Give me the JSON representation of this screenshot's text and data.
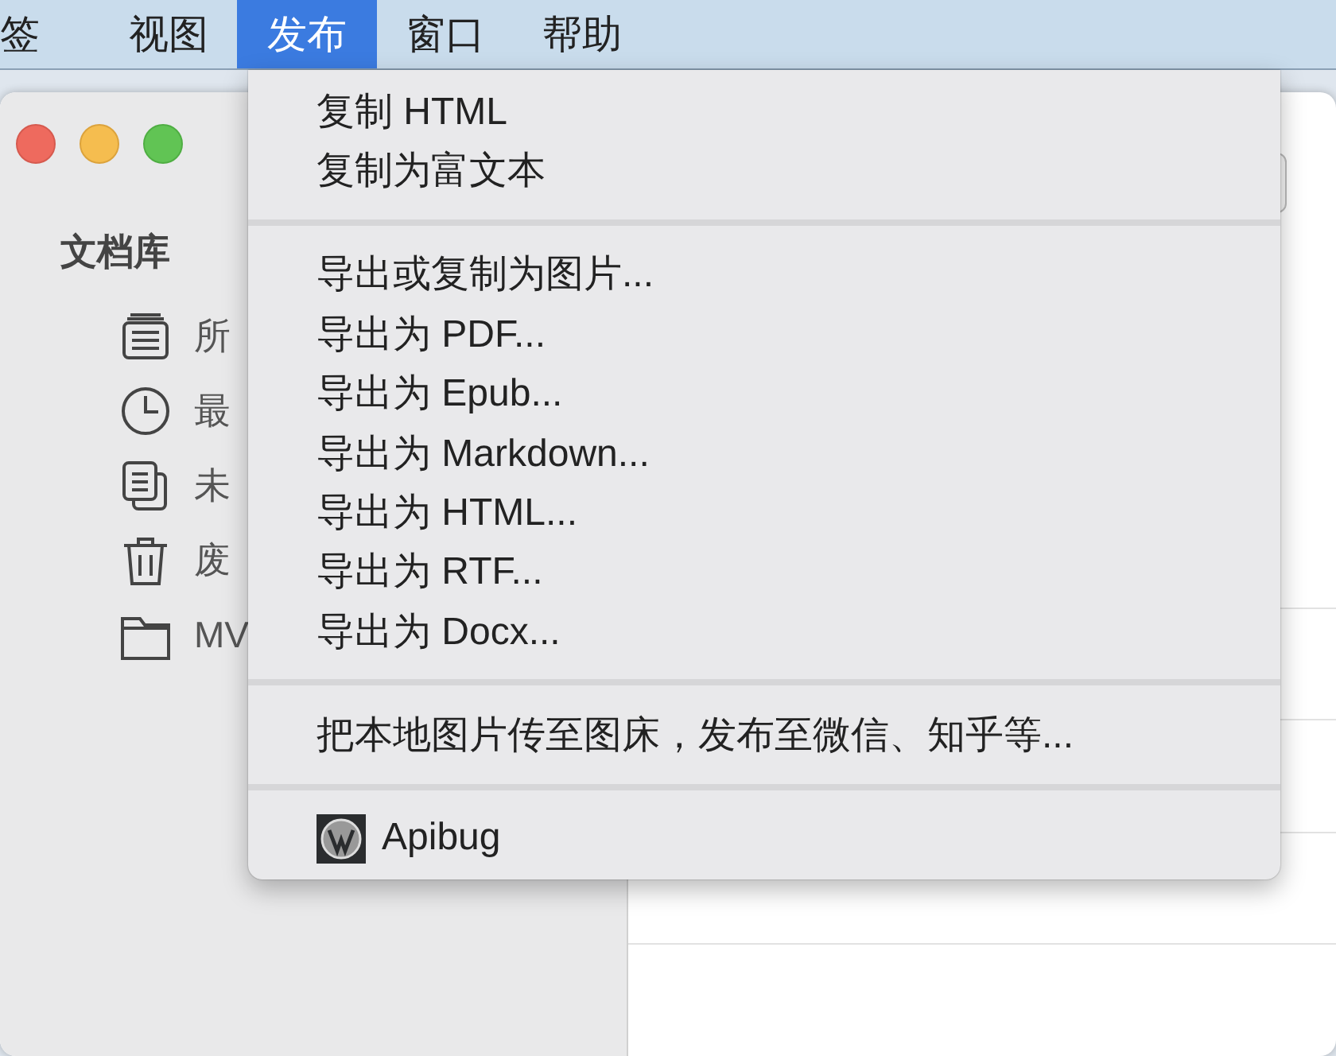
{
  "menu_bar": [
    {
      "label": "签",
      "selected": false
    },
    {
      "label": "视图",
      "selected": false
    },
    {
      "label": "发布",
      "selected": true
    },
    {
      "label": "窗口",
      "selected": false
    },
    {
      "label": "帮助",
      "selected": false
    }
  ],
  "window": {
    "sidebar": {
      "heading": "文档库",
      "items": [
        {
          "kind": "stack",
          "label": "所"
        },
        {
          "kind": "clock",
          "label": "最"
        },
        {
          "kind": "copies",
          "label": "未"
        },
        {
          "kind": "trash",
          "label": "废"
        },
        {
          "kind": "folder",
          "label": "MV"
        }
      ]
    }
  },
  "menu": [
    {
      "kind": "item",
      "label": "复制 HTML"
    },
    {
      "kind": "item",
      "label": "复制为富文本"
    },
    {
      "kind": "separator"
    },
    {
      "kind": "item",
      "label": "导出或复制为图片..."
    },
    {
      "kind": "item",
      "label": "导出为 PDF..."
    },
    {
      "kind": "item",
      "label": "导出为 Epub..."
    },
    {
      "kind": "item",
      "label": "导出为 Markdown..."
    },
    {
      "kind": "item",
      "label": "导出为 HTML..."
    },
    {
      "kind": "item",
      "label": "导出为 RTF..."
    },
    {
      "kind": "item",
      "label": "导出为 Docx..."
    },
    {
      "kind": "separator"
    },
    {
      "kind": "item",
      "label": "把本地图片传至图床，发布至微信、知乎等..."
    },
    {
      "kind": "separator"
    },
    {
      "kind": "wordpress",
      "label": "Apibug"
    }
  ]
}
